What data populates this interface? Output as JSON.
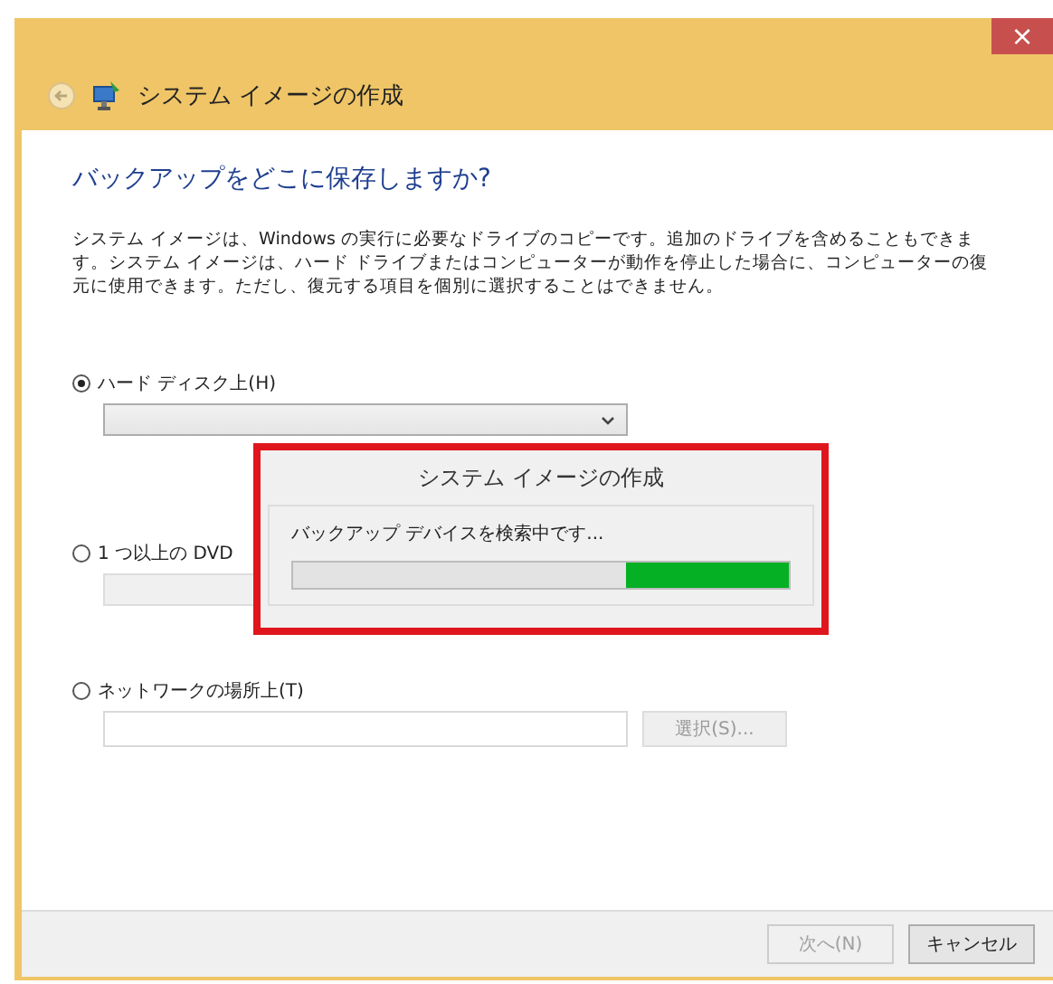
{
  "window": {
    "title": "システム イメージの作成",
    "close": "×"
  },
  "heading": "バックアップをどこに保存しますか?",
  "description": "システム イメージは、Windows の実行に必要なドライブのコピーです。追加のドライブを含めることもできます。システム イメージは、ハード ドライブまたはコンピューターが動作を停止した場合に、コンピューターの復元に使用できます。ただし、復元する項目を個別に選択することはできません。",
  "options": [
    {
      "label": "ハード ディスク上(H)",
      "selected": true,
      "kind": "dropdown"
    },
    {
      "label": "1 つ以上の DVD",
      "selected": false,
      "kind": "dropdown"
    },
    {
      "label": "ネットワークの場所上(T)",
      "selected": false,
      "kind": "path",
      "button": "選択(S)..."
    }
  ],
  "progress_dialog": {
    "title": "システム イメージの作成",
    "message": "バックアップ デバイスを検索中です...",
    "level": 0.33
  },
  "buttons": [
    {
      "label": "次へ(N)",
      "disabled": true
    },
    {
      "label": "キャンセル",
      "disabled": false
    }
  ]
}
